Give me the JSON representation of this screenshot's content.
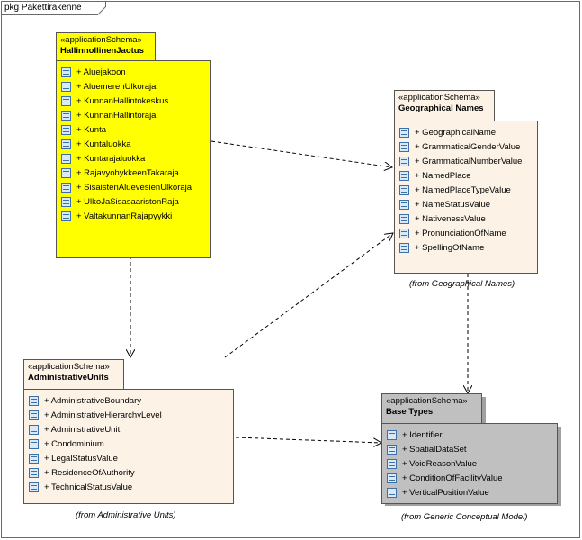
{
  "frame": {
    "title": "pkg Pakettirakenne"
  },
  "packages": {
    "hallinnollinen": {
      "stereotype": "«applicationSchema»",
      "name": "HallinnollinenJaotus",
      "items": [
        "+ Aluejakoon",
        "+ AluemerenUlkoraja",
        "+ KunnanHallintokeskus",
        "+ KunnanHallintoraja",
        "+ Kunta",
        "+ Kuntaluokka",
        "+ Kuntarajaluokka",
        "+ RajavyohykkeenTakaraja",
        "+ SisaistenAluevesienUlkoraja",
        "+ UlkoJaSisasaaristonRaja",
        "+ ValtakunnanRajapyykki"
      ]
    },
    "geographical": {
      "stereotype": "«applicationSchema»",
      "name": "Geographical Names",
      "items": [
        "+ GeographicalName",
        "+ GrammaticalGenderValue",
        "+ GrammaticalNumberValue",
        "+ NamedPlace",
        "+ NamedPlaceTypeValue",
        "+ NameStatusValue",
        "+ NativenessValue",
        "+ PronunciationOfName",
        "+ SpellingOfName"
      ],
      "caption": "(from Geographical Names)"
    },
    "administrative": {
      "stereotype": "«applicationSchema»",
      "name": "AdministrativeUnits",
      "items": [
        "+ AdministrativeBoundary",
        "+ AdministrativeHierarchyLevel",
        "+ AdministrativeUnit",
        "+ Condominium",
        "+ LegalStatusValue",
        "+ ResidenceOfAuthority",
        "+ TechnicalStatusValue"
      ],
      "caption": "(from Administrative Units)"
    },
    "basetypes": {
      "stereotype": "«applicationSchema»",
      "name": "Base Types",
      "items": [
        "+ Identifier",
        "+ SpatialDataSet",
        "+ VoidReasonValue",
        "+ ConditionOfFacilityValue",
        "+ VerticalPositionValue"
      ],
      "caption": "(from Generic Conceptual Model)"
    }
  },
  "icons": {
    "class_item": "class-icon"
  },
  "colors": {
    "hallinnollinen_fill": "#ffff00",
    "schema_fill": "#fcf3e6",
    "basetypes_fill": "#c0c0c0",
    "border": "#555555"
  }
}
